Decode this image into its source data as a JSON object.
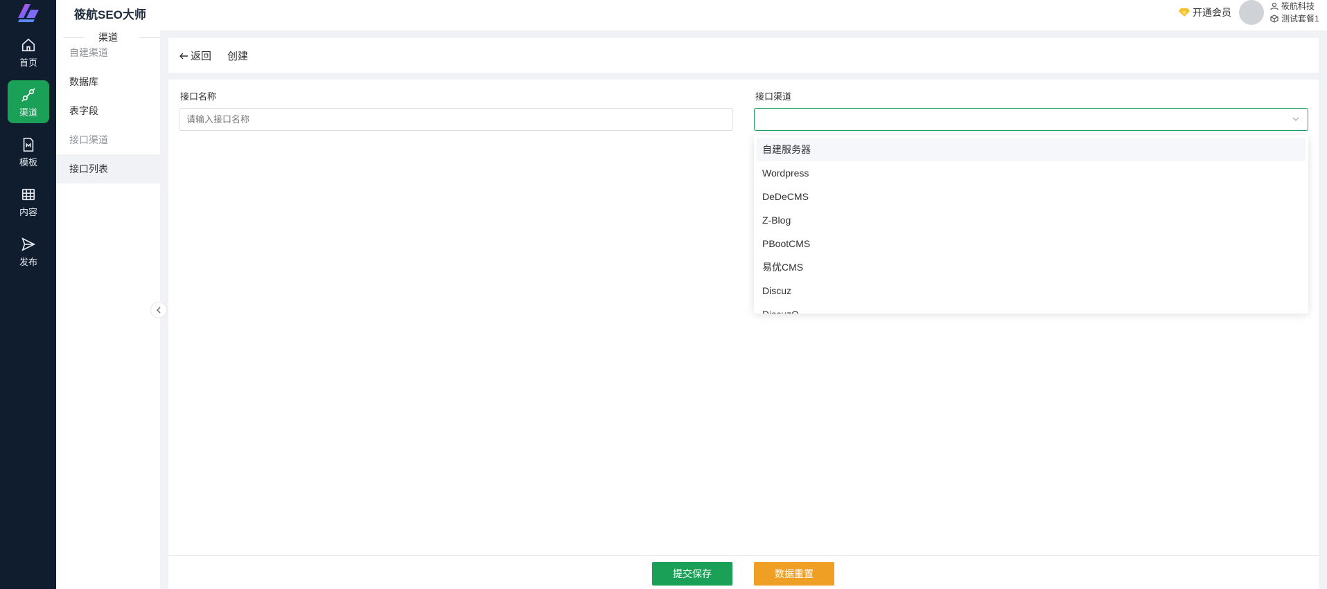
{
  "header": {
    "app_title": "筱航SEO大师",
    "vip_label": "开通会员",
    "user_name": "筱航科技",
    "plan_name": "测试套餐1"
  },
  "nav": [
    {
      "label": "首页",
      "icon": "home-icon"
    },
    {
      "label": "渠道",
      "icon": "channel-icon",
      "active": true
    },
    {
      "label": "模板",
      "icon": "template-icon"
    },
    {
      "label": "内容",
      "icon": "content-icon"
    },
    {
      "label": "发布",
      "icon": "publish-icon"
    }
  ],
  "submenu": {
    "title": "渠道",
    "items": [
      {
        "label": "自建渠道"
      },
      {
        "label": "数据库"
      },
      {
        "label": "表字段"
      },
      {
        "label": "接口渠道"
      },
      {
        "label": "接口列表",
        "active": true
      }
    ]
  },
  "page": {
    "back_label": "返回",
    "title": "创建"
  },
  "form": {
    "name_label": "接口名称",
    "name_placeholder": "请输入接口名称",
    "channel_label": "接口渠道",
    "channel_value": ""
  },
  "dropdown": {
    "options": [
      "自建服务器",
      "Wordpress",
      "DeDeCMS",
      "Z-Blog",
      "PBootCMS",
      "易优CMS",
      "Discuz",
      "DiscuzQ"
    ]
  },
  "buttons": {
    "save": "提交保存",
    "reset": "数据重置"
  },
  "colors": {
    "nav_bg": "#0f1d2f",
    "accent": "#1ba057",
    "warning": "#ef9f24"
  }
}
